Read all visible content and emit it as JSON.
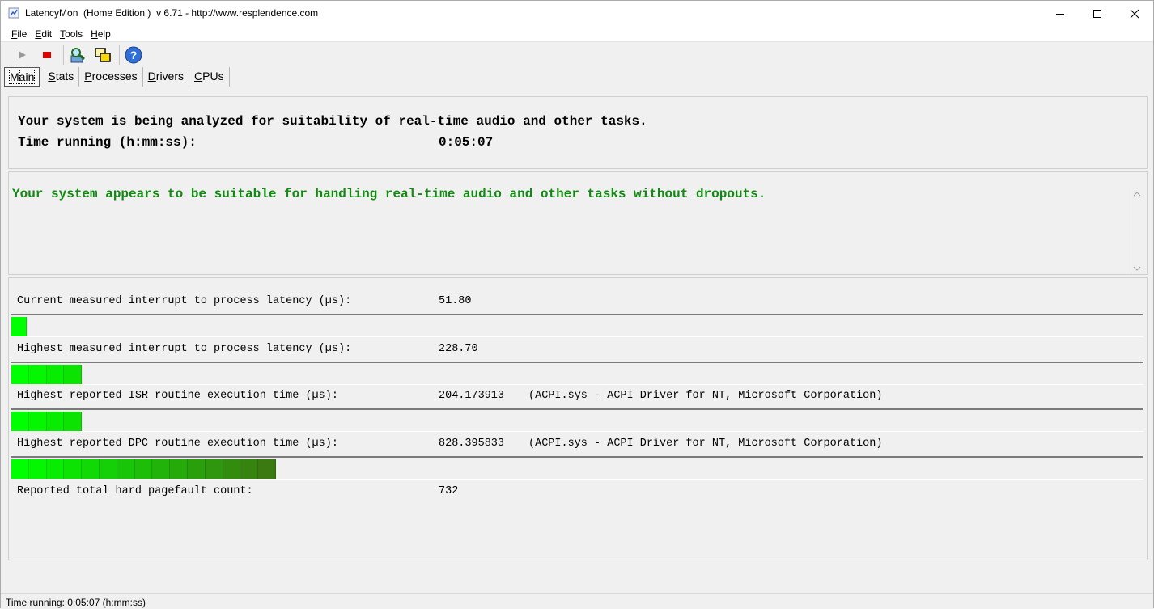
{
  "window": {
    "title": "LatencyMon  (Home Edition )  v 6.71 - http://www.resplendence.com",
    "controls": {
      "minimize_icon": "minimize-icon",
      "maximize_icon": "maximize-icon",
      "close_icon": "close-icon"
    }
  },
  "menu": [
    {
      "label": "File",
      "accel": "F",
      "rest": "ile"
    },
    {
      "label": "Edit",
      "accel": "E",
      "rest": "dit"
    },
    {
      "label": "Tools",
      "accel": "T",
      "rest": "ools"
    },
    {
      "label": "Help",
      "accel": "H",
      "rest": "elp"
    }
  ],
  "toolbar": {
    "items": [
      "play-icon",
      "stop-icon",
      "analyze-icon",
      "windows-icon",
      "help-icon"
    ]
  },
  "tabs": [
    {
      "label": "Main",
      "accel": "M",
      "rest": "ain",
      "active": true
    },
    {
      "label": "Stats",
      "accel": "S",
      "rest": "tats",
      "active": false
    },
    {
      "label": "Processes",
      "accel": "P",
      "rest": "rocesses",
      "active": false
    },
    {
      "label": "Drivers",
      "accel": "D",
      "rest": "rivers",
      "active": false
    },
    {
      "label": "CPUs",
      "accel": "C",
      "rest": "PUs",
      "active": false
    }
  ],
  "main": {
    "analyzing_text": "Your system is being analyzed for suitability of real-time audio and other tasks.",
    "time_running_label": "Time running (h:mm:ss):",
    "time_running_value": "0:05:07",
    "verdict": "Your system appears to be suitable for handling real-time audio and other tasks without dropouts.",
    "verdict_color": "#118a11"
  },
  "metrics": [
    {
      "label": "Current measured interrupt to process latency (µs):",
      "value": "51.80",
      "source": "",
      "bar_segments": 1
    },
    {
      "label": "Highest measured interrupt to process latency (µs):",
      "value": "228.70",
      "source": "",
      "bar_segments": 4
    },
    {
      "label": "Highest reported ISR routine execution time (µs):",
      "value": "204.173913",
      "source": "(ACPI.sys - ACPI Driver for NT, Microsoft Corporation)",
      "bar_segments": 4
    },
    {
      "label": "Highest reported DPC routine execution time (µs):",
      "value": "828.395833",
      "source": "(ACPI.sys - ACPI Driver for NT, Microsoft Corporation)",
      "bar_segments": 15
    },
    {
      "label": "Reported total hard pagefault count:",
      "value": "732",
      "source": ""
    }
  ],
  "colors": {
    "bar_start": "#00ff00",
    "bar_end": "#3a7a10"
  },
  "statusbar": {
    "text": "Time running: 0:05:07  (h:mm:ss)"
  }
}
